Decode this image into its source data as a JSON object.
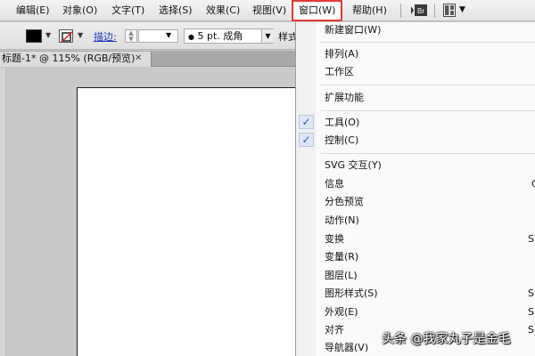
{
  "menubar": {
    "items": [
      {
        "id": "edit",
        "label": "编辑(E)"
      },
      {
        "id": "object",
        "label": "对象(O)"
      },
      {
        "id": "type",
        "label": "文字(T)"
      },
      {
        "id": "select",
        "label": "选择(S)"
      },
      {
        "id": "effect",
        "label": "效果(C)"
      },
      {
        "id": "view",
        "label": "视图(V)"
      },
      {
        "id": "window",
        "label": "窗口(W)",
        "active": true
      },
      {
        "id": "help",
        "label": "帮助(H)"
      }
    ],
    "bridge_icon_text": "Br"
  },
  "controlbar": {
    "fill_color": "#000000",
    "stroke_label": "描边:",
    "brush_value": "5 pt. 成角",
    "style_label": "样式"
  },
  "document_tab": {
    "title": "标题-1* @ 115% (RGB/预览)",
    "close_glyph": "✕"
  },
  "window_menu": {
    "items": [
      {
        "label": "新建窗口(W)"
      },
      {
        "label": "排列(A)"
      },
      {
        "label": "工作区"
      },
      {
        "label": "扩展功能"
      },
      {
        "label": "工具(O)",
        "checked": true
      },
      {
        "label": "控制(C)",
        "checked": true
      },
      {
        "label": "SVG 交互(Y)"
      },
      {
        "label": "信息",
        "shortcut": "C"
      },
      {
        "label": "分色预览"
      },
      {
        "label": "动作(N)"
      },
      {
        "label": "变换",
        "shortcut": "S"
      },
      {
        "label": "变量(R)"
      },
      {
        "label": "图层(L)"
      },
      {
        "label": "图形样式(S)",
        "shortcut": "S"
      },
      {
        "label": "外观(E)",
        "shortcut": "S"
      },
      {
        "label": "对齐",
        "shortcut": "S"
      },
      {
        "label": "导航器(V)"
      }
    ],
    "check_glyph": "✓"
  },
  "watermark": "头条 @我家丸子是金毛",
  "colors": {
    "highlight_border": "#e53935",
    "check_accent": "#2f5aa6",
    "stroke_link": "#1a35c4"
  }
}
